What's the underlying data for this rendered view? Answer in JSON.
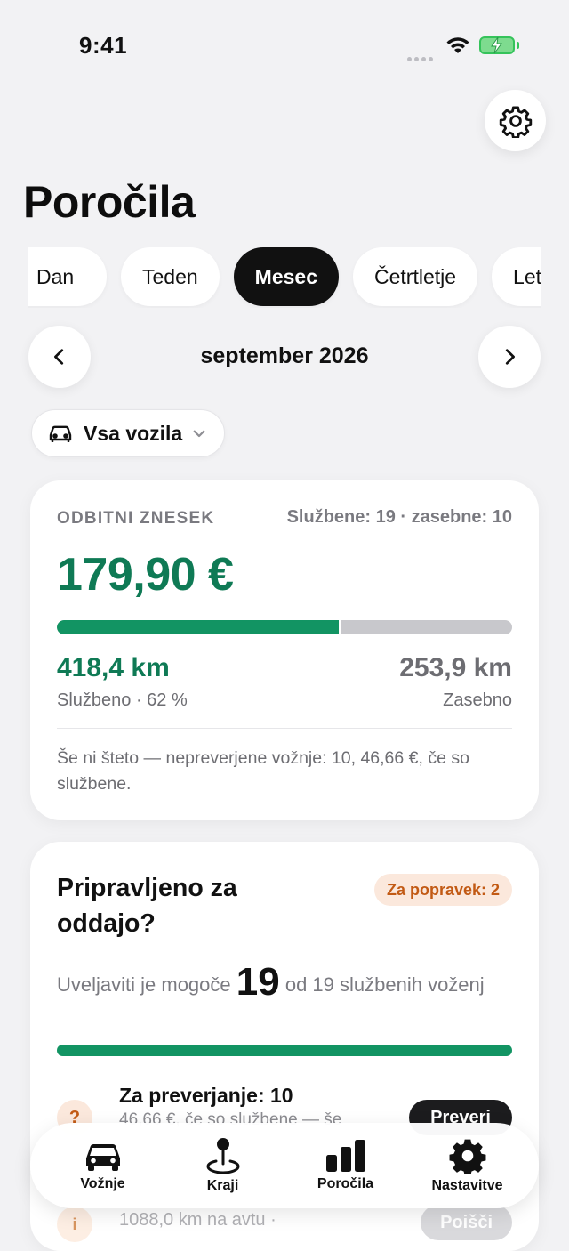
{
  "status_bar": {
    "time": "9:41"
  },
  "header": {
    "title": "Poročila"
  },
  "period_tabs": [
    {
      "label": "Dan",
      "active": false
    },
    {
      "label": "Teden",
      "active": false
    },
    {
      "label": "Mesec",
      "active": true
    },
    {
      "label": "Četrtletje",
      "active": false
    },
    {
      "label": "Leto",
      "active": false
    }
  ],
  "period": {
    "label": "september 2026"
  },
  "vehicle_filter": {
    "label": "Vsa vozila"
  },
  "deduction_card": {
    "label": "ODBITNI ZNESEK",
    "counts": "Službene: 19 · zasebne: 10",
    "amount": "179,90 €",
    "business_fraction": 0.62,
    "business_km": "418,4 km",
    "business_sub": "Službeno · 62 %",
    "private_km": "253,9 km",
    "private_sub": "Zasebno",
    "note": "Še ni šteto — nepreverjene vožnje: 10, 46,66 €, če so službene."
  },
  "ready_card": {
    "title": "Pripravljeno za oddajo?",
    "badge": "Za popravek: 2",
    "line_prefix": "Uveljaviti je mogoče",
    "line_count": "19",
    "line_suffix": "od 19 službenih voženj",
    "progress": 1.0,
    "review_title": "Za preverjanje: 10",
    "review_sub": "46,66 €, če so službene — še",
    "review_button": "Preveri",
    "odometer_sub": "1088,0 km na avtu ·",
    "odometer_button": "Poišči"
  },
  "tabbar": {
    "items": [
      {
        "label": "Vožnje",
        "icon": "car-icon"
      },
      {
        "label": "Kraji",
        "icon": "location-pin-icon"
      },
      {
        "label": "Poročila",
        "icon": "bar-chart-icon"
      },
      {
        "label": "Nastavitve",
        "icon": "gear-icon"
      }
    ]
  },
  "colors": {
    "accent_green": "#129463",
    "warning_orange": "#c25a14",
    "background": "#f2f2f4"
  }
}
